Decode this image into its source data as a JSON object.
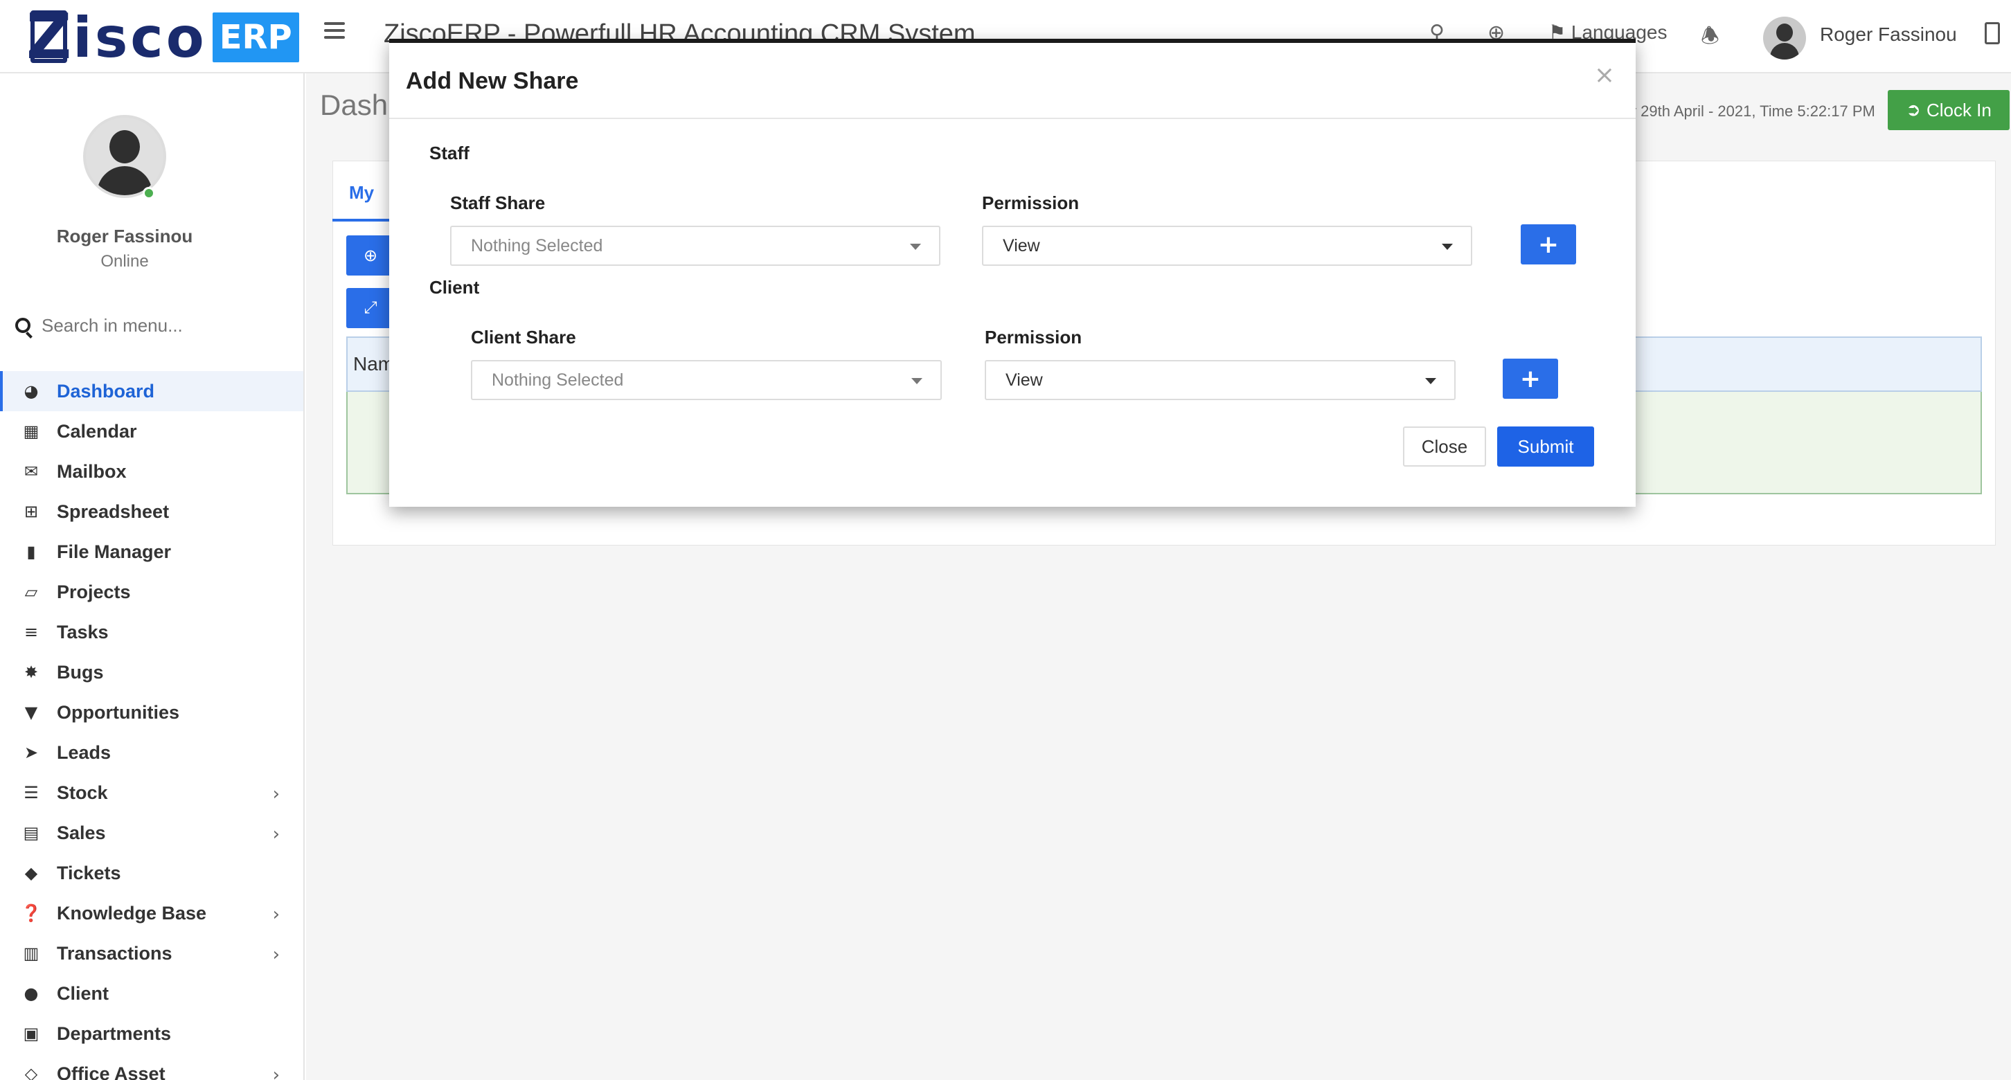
{
  "header": {
    "logo_letter": "Z",
    "logo_text": "isco",
    "logo_badge": "ERP",
    "title": "ZiscoERP - Powerfull HR Accounting CRM System",
    "languages": "Languages",
    "user_name": "Roger Fassinou"
  },
  "sidebar": {
    "profile_name": "Roger Fassinou",
    "profile_status": "Online",
    "search_placeholder": "Search in menu...",
    "items": [
      {
        "label": "Dashboard",
        "icon": "dashboard-icon",
        "active": true,
        "has_submenu": false
      },
      {
        "label": "Calendar",
        "icon": "calendar-icon",
        "active": false,
        "has_submenu": false
      },
      {
        "label": "Mailbox",
        "icon": "envelope-icon",
        "active": false,
        "has_submenu": false
      },
      {
        "label": "Spreadsheet",
        "icon": "spreadsheet-icon",
        "active": false,
        "has_submenu": false
      },
      {
        "label": "File Manager",
        "icon": "file-icon",
        "active": false,
        "has_submenu": false
      },
      {
        "label": "Projects",
        "icon": "folder-icon",
        "active": false,
        "has_submenu": false
      },
      {
        "label": "Tasks",
        "icon": "tasks-icon",
        "active": false,
        "has_submenu": false
      },
      {
        "label": "Bugs",
        "icon": "bug-icon",
        "active": false,
        "has_submenu": false
      },
      {
        "label": "Opportunities",
        "icon": "filter-icon",
        "active": false,
        "has_submenu": false
      },
      {
        "label": "Leads",
        "icon": "rocket-icon",
        "active": false,
        "has_submenu": false
      },
      {
        "label": "Stock",
        "icon": "layers-icon",
        "active": false,
        "has_submenu": true
      },
      {
        "label": "Sales",
        "icon": "cart-icon",
        "active": false,
        "has_submenu": true
      },
      {
        "label": "Tickets",
        "icon": "ticket-icon",
        "active": false,
        "has_submenu": false
      },
      {
        "label": "Knowledge Base",
        "icon": "question-icon",
        "active": false,
        "has_submenu": true
      },
      {
        "label": "Transactions",
        "icon": "building-icon",
        "active": false,
        "has_submenu": true
      },
      {
        "label": "Client",
        "icon": "users-icon",
        "active": false,
        "has_submenu": false
      },
      {
        "label": "Departments",
        "icon": "lock-icon",
        "active": false,
        "has_submenu": false
      },
      {
        "label": "Office Asset",
        "icon": "asset-icon",
        "active": false,
        "has_submenu": true
      }
    ]
  },
  "content": {
    "page_title": "Dash",
    "datetime": "y 29th April - 2021,  Time   5:22:17 PM",
    "clock_in": "Clock In",
    "tab_my": "My",
    "table_head": "Nam"
  },
  "modal": {
    "title": "Add New Share",
    "close_x": "×",
    "staff_section": "Staff",
    "staff_share_label": "Staff Share",
    "staff_share_value": "Nothing Selected",
    "staff_permission_label": "Permission",
    "staff_permission_value": "View",
    "client_section": "Client",
    "client_share_label": "Client Share",
    "client_share_value": "Nothing Selected",
    "client_permission_label": "Permission",
    "client_permission_value": "View",
    "add_symbol": "+",
    "close_button": "Close",
    "submit_button": "Submit"
  },
  "colors": {
    "primary": "#2a6ee8",
    "success": "#43a047",
    "brand_dark": "#1a2b6d",
    "brand_badge": "#2196f3"
  }
}
